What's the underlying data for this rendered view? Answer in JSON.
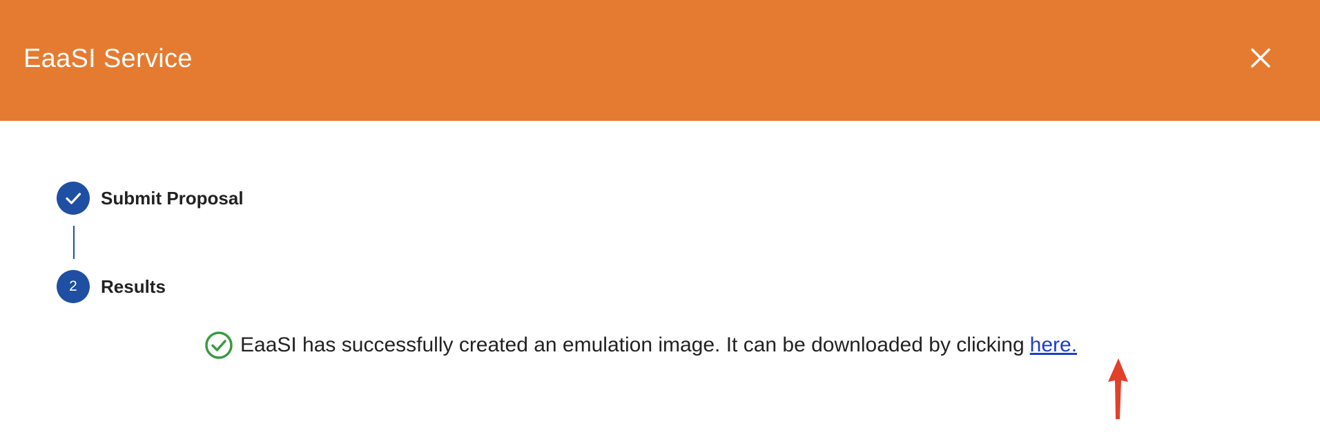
{
  "dialog": {
    "title": "EaaSI Service",
    "close_icon": "close-icon"
  },
  "stepper": {
    "steps": [
      {
        "marker": "check-icon",
        "label": "Submit Proposal",
        "state": "completed"
      },
      {
        "marker": "2",
        "label": "Results",
        "state": "active"
      }
    ]
  },
  "result": {
    "status_icon": "check-circle-icon",
    "message": "EaaSI has successfully created an emulation image. It can be downloaded by clicking",
    "link_text": "here."
  },
  "annotation": {
    "icon": "red-arrow-up-icon"
  },
  "colors": {
    "header": "#e57b30",
    "step_accent": "#1e4fa3",
    "success": "#3a9a3f",
    "link": "#1a3ec9",
    "annotation": "#e0412b"
  }
}
